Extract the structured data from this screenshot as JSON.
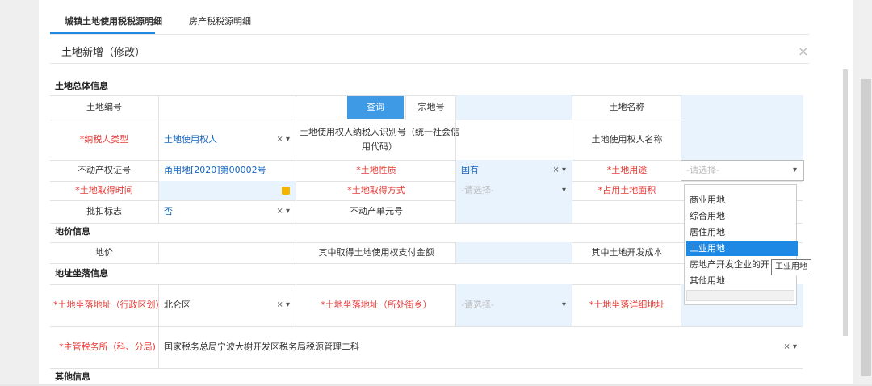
{
  "tabs": {
    "land": "城镇土地使用税税源明细",
    "house": "房产税税源明细"
  },
  "dialog": {
    "title": "土地新增（修改）",
    "close": "×"
  },
  "sections": {
    "general": "土地总体信息",
    "price": "地价信息",
    "address": "地址坐落信息",
    "other": "其他信息"
  },
  "labels": {
    "land_no": "土地编号",
    "query": "查询",
    "parcel_no": "宗地号",
    "land_name": "土地名称",
    "taxpayer_type": "*纳税人类型",
    "taxpayer_id": "土地使用权人纳税人识别号（统一社会信用代码）",
    "user_name": "土地使用权人名称",
    "cert_no": "不动产权证号",
    "land_nature": "*土地性质",
    "land_use": "*土地用途",
    "acquire_time": "*土地取得时间",
    "acquire_way": "*土地取得方式",
    "occupy_area": "*占用土地面积",
    "deduct_flag": "批扣标志",
    "unit_no": "不动产单元号",
    "price": "地价",
    "acquire_cost": "其中取得土地使用权支付金额",
    "dev_cost": "其中土地开发成本",
    "district": "*土地坐落地址（行政区划）",
    "street": "*土地坐落地址（所处街乡）",
    "detail_addr": "*土地坐落详细地址",
    "tax_office": "*主管税务所（科、分局)"
  },
  "values": {
    "taxpayer_type": "土地使用权人",
    "cert_no": "甬用地[2020]第00002号",
    "land_nature": "国有",
    "placeholder": "-请选择-",
    "deduct_flag": "否",
    "district": "北仑区",
    "tax_office": "国家税务总局宁波大榭开发区税务局税源管理二科"
  },
  "controls": {
    "clear_arrow": "× ▾",
    "arrow": "▾"
  },
  "dropdown": {
    "items": [
      "商业用地",
      "综合用地",
      "居住用地",
      "工业用地",
      "房地产开发企业的开",
      "其他用地"
    ],
    "selected": "工业用地",
    "tooltip": "工业用地"
  }
}
